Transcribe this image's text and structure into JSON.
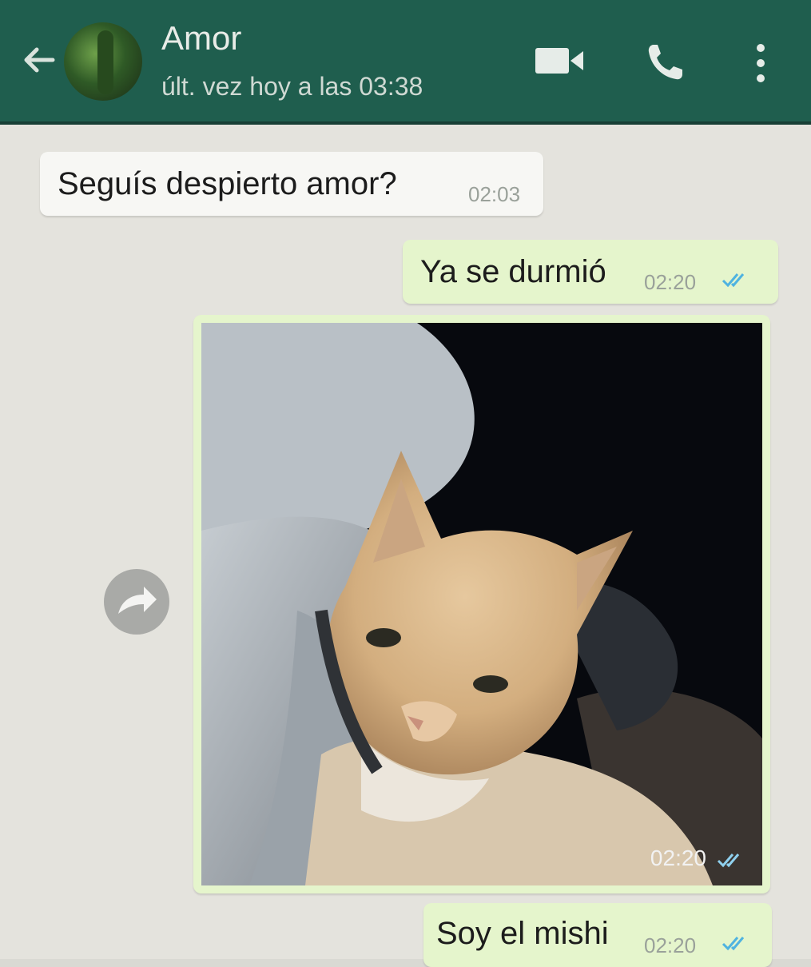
{
  "header": {
    "back_icon": "arrow-left-icon",
    "contact_name": "Amor",
    "last_seen": "últ. vez hoy a las 03:38",
    "video_icon": "video-call-icon",
    "call_icon": "phone-icon",
    "menu_icon": "more-vert-icon",
    "bar_color": "#1f5e4e"
  },
  "messages": [
    {
      "direction": "incoming",
      "text": "Seguís despierto amor?",
      "time": "02:03"
    },
    {
      "direction": "outgoing",
      "text": "Ya se durmió",
      "time": "02:20",
      "status_icon": "double-check-read-icon"
    },
    {
      "direction": "outgoing",
      "type": "image",
      "image": "cat-photo",
      "time": "02:20",
      "status_icon": "double-check-read-icon",
      "forward_icon": "forward-share-icon"
    },
    {
      "direction": "outgoing",
      "text": "Soy el mishi",
      "time": "02:20",
      "status_icon": "double-check-read-icon"
    }
  ],
  "colors": {
    "outgoing_bubble": "#e5f5cc",
    "incoming_bubble": "#f7f7f4",
    "read_ticks": "#4fb3e0"
  }
}
